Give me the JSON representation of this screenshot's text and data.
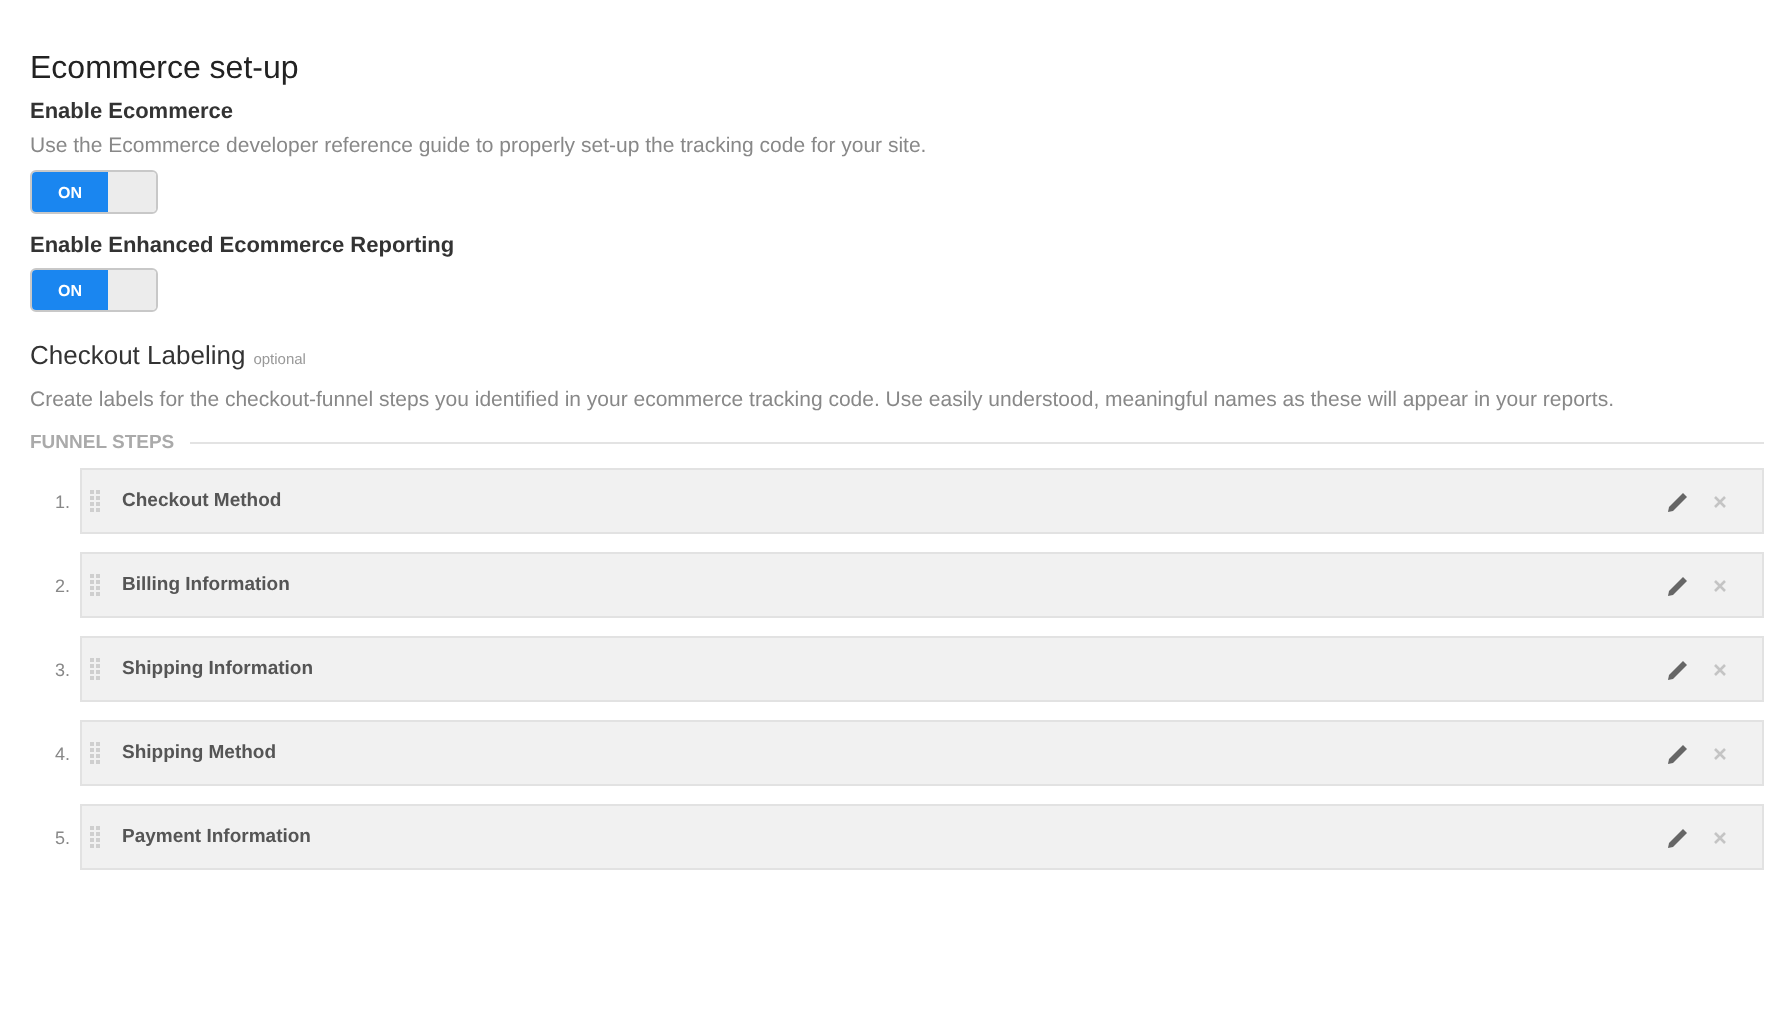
{
  "title": "Ecommerce set-up",
  "settings": [
    {
      "label": "Enable Ecommerce",
      "description": "Use the Ecommerce developer reference guide to properly set-up the tracking code for your site.",
      "toggle": {
        "text": "ON",
        "on": true
      }
    },
    {
      "label": "Enable Enhanced Ecommerce Reporting",
      "toggle": {
        "text": "ON",
        "on": true
      }
    }
  ],
  "checkout": {
    "title": "Checkout Labeling",
    "badge": "optional",
    "description": "Create labels for the checkout-funnel steps you identified in your ecommerce tracking code. Use easily understood, meaningful names as these will appear in your reports.",
    "section": "FUNNEL STEPS",
    "steps": [
      {
        "number": "1.",
        "name": "Checkout Method"
      },
      {
        "number": "2.",
        "name": "Billing Information"
      },
      {
        "number": "3.",
        "name": "Shipping Information"
      },
      {
        "number": "4.",
        "name": "Shipping Method"
      },
      {
        "number": "5.",
        "name": "Payment Information"
      }
    ]
  }
}
